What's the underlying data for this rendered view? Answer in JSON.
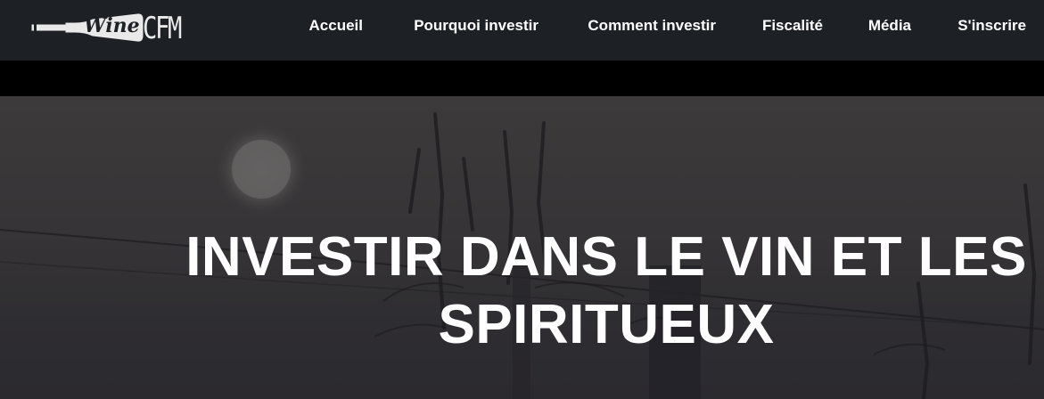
{
  "brand": {
    "logo_word": "Wine",
    "logo_suffix": "CFM",
    "logo_icon": "wine-bottle-icon"
  },
  "nav": {
    "items": [
      {
        "label": "Accueil"
      },
      {
        "label": "Pourquoi investir"
      },
      {
        "label": "Comment investir"
      },
      {
        "label": "Fiscalité"
      },
      {
        "label": "Média"
      },
      {
        "label": "S'inscrire"
      }
    ]
  },
  "hero": {
    "title_line1": "INVESTIR DANS LE VIN ET LES",
    "title_line2": "SPIRITUEUX"
  },
  "colors": {
    "header_bg": "#1d2024",
    "band": "#000000",
    "text": "#ffffff"
  }
}
